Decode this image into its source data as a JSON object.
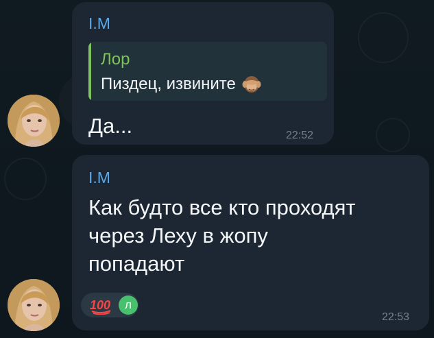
{
  "colors": {
    "background": "#0f1920",
    "bubble": "#1c2733",
    "sender": "#58a8e9",
    "reply_accent": "#7fc35b",
    "time": "#76808a",
    "reaction_avatar": "#49c06d"
  },
  "messages": [
    {
      "sender": "I.M",
      "reply": {
        "name": "Лор",
        "text": "Пиздец, извините",
        "emoji_icon": "see-no-evil-monkey-icon"
      },
      "text": "Да...",
      "time": "22:52"
    },
    {
      "sender": "I.M",
      "text": "Как будто все кто проходят\nчерез Леху в жопу\nпопадают",
      "time": "22:53",
      "reaction": {
        "emoji": "100",
        "avatar_letter": "л"
      }
    }
  ]
}
